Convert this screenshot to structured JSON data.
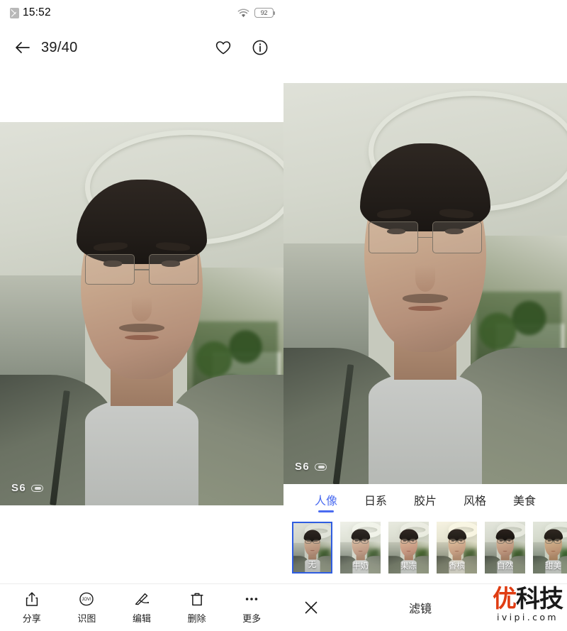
{
  "status_bar": {
    "time": "15:52",
    "sim_icon": "sim-card-icon",
    "wifi_icon": "wifi-icon",
    "battery_level": "92"
  },
  "viewer": {
    "back_icon": "back-arrow-icon",
    "counter": "39/40",
    "favorite_icon": "heart-icon",
    "info_icon": "info-icon",
    "photo_watermark": "S6"
  },
  "toolbar": {
    "items": [
      {
        "label": "分享",
        "icon": "share-icon"
      },
      {
        "label": "识图",
        "icon": "jovi-image-recognition-icon"
      },
      {
        "label": "编辑",
        "icon": "edit-pen-icon"
      },
      {
        "label": "删除",
        "icon": "trash-icon"
      },
      {
        "label": "更多",
        "icon": "more-dots-icon"
      }
    ]
  },
  "editor": {
    "photo_watermark": "S6",
    "close_icon": "close-x-icon",
    "mode_label": "滤镜",
    "tabs": [
      {
        "label": "人像",
        "active": true
      },
      {
        "label": "日系",
        "active": false
      },
      {
        "label": "胶片",
        "active": false
      },
      {
        "label": "风格",
        "active": false
      },
      {
        "label": "美食",
        "active": false
      }
    ],
    "filters": [
      {
        "label": "无",
        "selected": true
      },
      {
        "label": "牛奶",
        "selected": false
      },
      {
        "label": "果冻",
        "selected": false
      },
      {
        "label": "香槟",
        "selected": false
      },
      {
        "label": "自然",
        "selected": false
      },
      {
        "label": "甜美",
        "selected": false
      }
    ]
  },
  "watermark_logo": {
    "brand_first": "优",
    "brand_rest": "科技",
    "url": "ivipi.com",
    "accent_color": "#e03c12"
  },
  "colors": {
    "accent_blue": "#4a6bf0",
    "selection_blue": "#2f5de0",
    "text_primary": "#1f1f1f",
    "divider": "#ececec"
  }
}
